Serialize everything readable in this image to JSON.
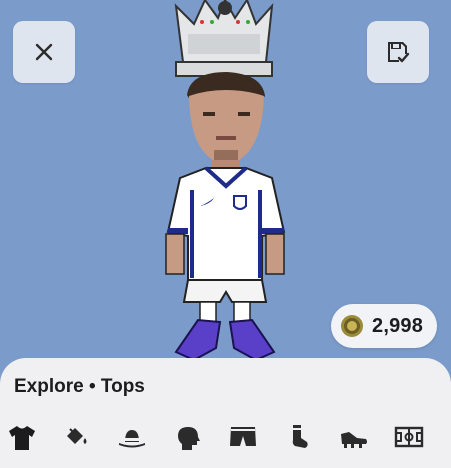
{
  "header": {
    "close_icon": "close-icon",
    "save_icon": "save-outfit-icon"
  },
  "coins": {
    "balance": "2,998",
    "icon": "coin-icon"
  },
  "avatar": {
    "headwear": "crown",
    "top": "England home shirt",
    "footwear": "purple football boots"
  },
  "sheet": {
    "title": "Explore • Tops",
    "categories": [
      {
        "name": "tops",
        "icon": "tshirt-icon",
        "selected": true
      },
      {
        "name": "paint",
        "icon": "paint-bucket-icon",
        "selected": false
      },
      {
        "name": "hats",
        "icon": "hat-icon",
        "selected": false
      },
      {
        "name": "head",
        "icon": "head-icon",
        "selected": false
      },
      {
        "name": "shorts",
        "icon": "shorts-icon",
        "selected": false
      },
      {
        "name": "socks",
        "icon": "sock-icon",
        "selected": false
      },
      {
        "name": "boots",
        "icon": "boot-icon",
        "selected": false
      },
      {
        "name": "pitch",
        "icon": "pitch-icon",
        "selected": false
      }
    ]
  },
  "colors": {
    "background": "#7b9bcb",
    "sheet": "#f0f0f2",
    "button": "#dfe5ee",
    "icon": "#2b2b2b"
  }
}
